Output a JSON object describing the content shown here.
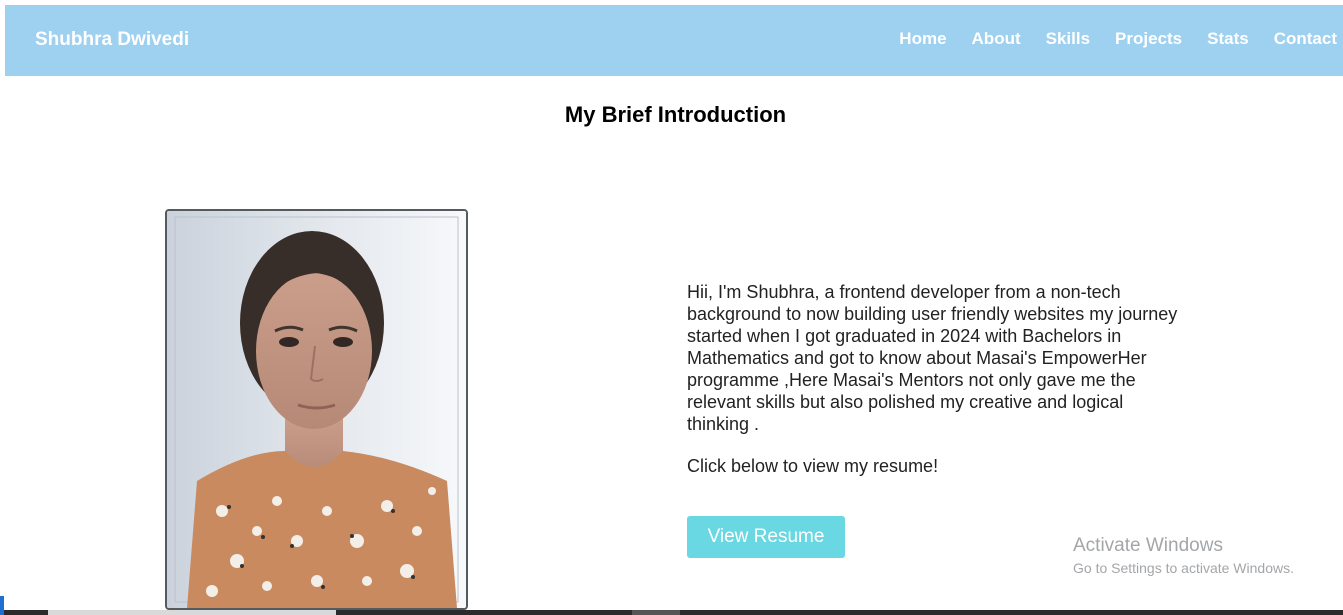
{
  "navbar": {
    "brand": "Shubhra Dwivedi",
    "links": [
      "Home",
      "About",
      "Skills",
      "Projects",
      "Stats",
      "Contact"
    ],
    "background_color": "#9ed0ef"
  },
  "main": {
    "title": "My Brief Introduction",
    "intro": "Hii, I'm Shubhra, a frontend developer from a non-tech background to now building user friendly websites my journey started when I got graduated in 2024 with Bachelors in Mathematics and got to know about Masai's EmpowerHer programme ,Here Masai's Mentors not only gave me the relevant skills but also polished my creative and logical thinking .",
    "resume_prompt": "Click below to view my resume!",
    "resume_button": "View Resume",
    "resume_button_color": "#6ad8e2"
  },
  "watermark": {
    "title": "Activate Windows",
    "subtitle": "Go to Settings to activate Windows."
  }
}
